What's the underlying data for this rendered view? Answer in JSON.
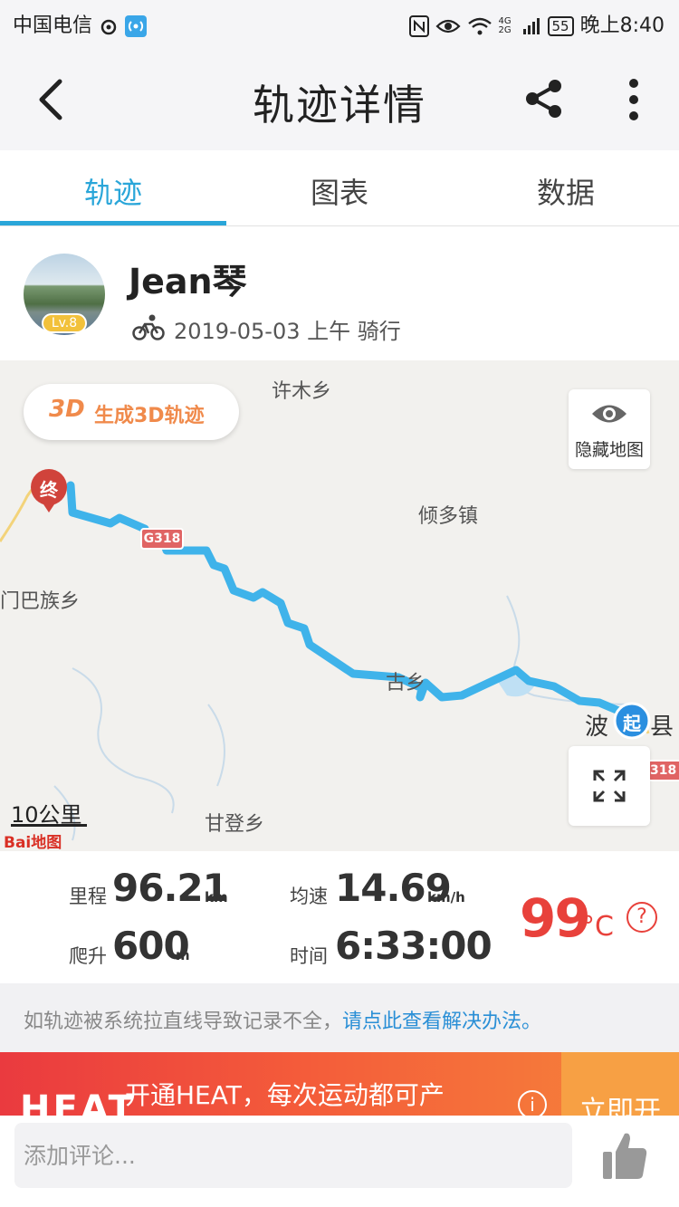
{
  "status_bar": {
    "carrier": "中国电信",
    "battery": "55",
    "time": "晚上8:40",
    "signal_label": "4G 2G"
  },
  "header": {
    "title": "轨迹详情"
  },
  "tabs": [
    {
      "label": "轨迹",
      "active": true
    },
    {
      "label": "图表",
      "active": false
    },
    {
      "label": "数据",
      "active": false
    }
  ],
  "profile": {
    "username": "Jean琴",
    "level": "Lv.8",
    "date": "2019-05-03 上午 骑行"
  },
  "map": {
    "btn_3d_tag": "3D",
    "btn_3d_label": "生成3D轨迹",
    "hide_map_label": "隐藏地图",
    "end_marker": "终",
    "start_marker": "起",
    "road_sign_1": "G318",
    "road_sign_2": "318",
    "places": [
      "许木乡",
      "倾多镇",
      "门巴族乡",
      "古乡",
      "波",
      "县",
      "甘登乡"
    ],
    "scale": "10公里",
    "provider": "Bai地图"
  },
  "stats": {
    "distance_label": "里程",
    "distance_value": "96.21",
    "distance_unit": "km",
    "avg_speed_label": "均速",
    "avg_speed_value": "14.69",
    "avg_speed_unit": "km/h",
    "climb_label": "爬升",
    "climb_value": "600",
    "climb_unit": "m",
    "time_label": "时间",
    "time_value": "6:33:00",
    "score": "99",
    "score_unit": "°C",
    "help": "?"
  },
  "notice": {
    "text": "如轨迹被系统拉直线导致记录不全，",
    "link": "请点此查看解决办法。"
  },
  "banner": {
    "logo": "HEAT",
    "text": "开通HEAT，每次运动都可产",
    "info": "i",
    "cta": "立即开"
  },
  "comment": {
    "placeholder": "添加评论..."
  },
  "colors": {
    "accent": "#2aa6d9",
    "track": "#3fb3ea",
    "score": "#e8413b",
    "end_marker": "#d0433b",
    "start_marker": "#2b8fe0"
  }
}
